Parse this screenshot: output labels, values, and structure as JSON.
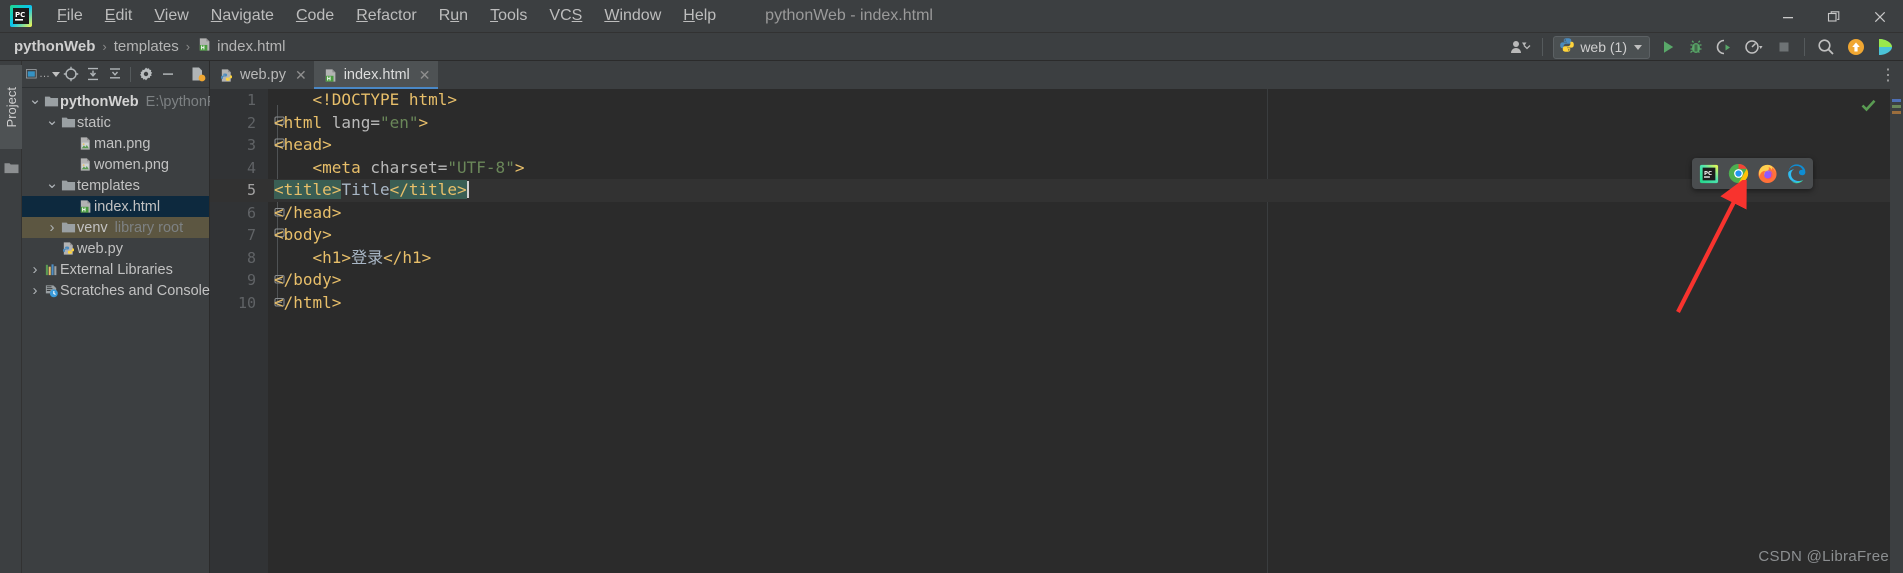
{
  "window": {
    "title": "pythonWeb - index.html",
    "controls": [
      {
        "name": "minimize",
        "glyph": "—"
      },
      {
        "name": "restore",
        "glyph": "❐"
      },
      {
        "name": "close",
        "glyph": "✕"
      }
    ]
  },
  "menubar": {
    "logo_text": "PC",
    "items": [
      {
        "label": "File",
        "mnemonic": "F"
      },
      {
        "label": "Edit",
        "mnemonic": "E"
      },
      {
        "label": "View",
        "mnemonic": "V"
      },
      {
        "label": "Navigate",
        "mnemonic": "N"
      },
      {
        "label": "Code",
        "mnemonic": "C"
      },
      {
        "label": "Refactor",
        "mnemonic": "R"
      },
      {
        "label": "Run",
        "mnemonic": "u"
      },
      {
        "label": "Tools",
        "mnemonic": "T"
      },
      {
        "label": "VCS",
        "mnemonic": "S"
      },
      {
        "label": "Window",
        "mnemonic": "W"
      },
      {
        "label": "Help",
        "mnemonic": "H"
      }
    ]
  },
  "navbar": {
    "breadcrumb": [
      {
        "label": "pythonWeb",
        "bold": true,
        "icon": ""
      },
      {
        "label": "templates",
        "bold": false,
        "icon": ""
      },
      {
        "label": "index.html",
        "bold": false,
        "icon": "html-file-icon"
      }
    ],
    "separator": "›",
    "run_config": {
      "label": "web (1)",
      "icon": "python-icon"
    },
    "actions": [
      {
        "name": "user-settings-icon",
        "label": ""
      },
      {
        "name": "run-icon",
        "label": ""
      },
      {
        "name": "debug-icon",
        "label": ""
      },
      {
        "name": "run-coverage-icon",
        "label": ""
      },
      {
        "name": "profile-icon",
        "label": ""
      },
      {
        "name": "stop-icon",
        "label": ""
      },
      {
        "name": "search-everywhere-icon",
        "label": ""
      },
      {
        "name": "update-project-icon",
        "label": ""
      }
    ]
  },
  "toolstrip": {
    "tab_label": "Project"
  },
  "project_panel": {
    "toolbar_buttons": [
      {
        "name": "project-view-selector",
        "label": "..."
      },
      {
        "name": "locate-icon",
        "label": ""
      },
      {
        "name": "expand-all-icon",
        "label": ""
      },
      {
        "name": "collapse-all-icon",
        "label": ""
      },
      {
        "name": "settings-gear-icon",
        "label": ""
      },
      {
        "name": "hide-panel-icon",
        "label": ""
      }
    ],
    "tree": [
      {
        "indent": 0,
        "arrow": "down",
        "icon": "folder-icon",
        "label": "pythonWeb",
        "bold": true,
        "sub": "E:\\pythonF",
        "state": "normal"
      },
      {
        "indent": 1,
        "arrow": "down",
        "icon": "folder-icon",
        "label": "static",
        "bold": false,
        "sub": "",
        "state": "normal"
      },
      {
        "indent": 2,
        "arrow": "none",
        "icon": "image-file-icon",
        "label": "man.png",
        "bold": false,
        "sub": "",
        "state": "normal"
      },
      {
        "indent": 2,
        "arrow": "none",
        "icon": "image-file-icon",
        "label": "women.png",
        "bold": false,
        "sub": "",
        "state": "normal"
      },
      {
        "indent": 1,
        "arrow": "down",
        "icon": "folder-icon",
        "label": "templates",
        "bold": false,
        "sub": "",
        "state": "normal"
      },
      {
        "indent": 2,
        "arrow": "none",
        "icon": "html-file-icon",
        "label": "index.html",
        "bold": false,
        "sub": "",
        "state": "selected"
      },
      {
        "indent": 1,
        "arrow": "right",
        "icon": "folder-icon",
        "label": "venv",
        "bold": false,
        "sub": "library root",
        "state": "highlight"
      },
      {
        "indent": 1,
        "arrow": "none",
        "icon": "python-file-icon",
        "label": "web.py",
        "bold": false,
        "sub": "",
        "state": "normal"
      },
      {
        "indent": 0,
        "arrow": "right",
        "icon": "libraries-icon",
        "label": "External Libraries",
        "bold": false,
        "sub": "",
        "state": "normal"
      },
      {
        "indent": 0,
        "arrow": "right",
        "icon": "scratches-icon",
        "label": "Scratches and Consoles",
        "bold": false,
        "sub": "",
        "state": "normal"
      }
    ]
  },
  "editor": {
    "tabs": [
      {
        "label": "web.py",
        "icon": "python-file-icon",
        "active": false,
        "close": "✕"
      },
      {
        "label": "index.html",
        "icon": "html-file-icon",
        "active": true,
        "close": "✕"
      }
    ],
    "options_glyph": "⋮",
    "inspection_status": "ok-check-icon",
    "current_line": 5,
    "lines": [
      {
        "no": "1",
        "fold": "",
        "bulb": false,
        "tokens": [
          {
            "t": "    ",
            "c": "plain"
          },
          {
            "t": "<!DOCTYPE html>",
            "c": "tag"
          }
        ]
      },
      {
        "no": "2",
        "fold": "open",
        "bulb": false,
        "tokens": [
          {
            "t": "<html ",
            "c": "tag"
          },
          {
            "t": "lang=",
            "c": "attr"
          },
          {
            "t": "\"en\"",
            "c": "str"
          },
          {
            "t": ">",
            "c": "tag"
          }
        ]
      },
      {
        "no": "3",
        "fold": "open",
        "bulb": false,
        "tokens": [
          {
            "t": "<head>",
            "c": "tag"
          }
        ]
      },
      {
        "no": "4",
        "fold": "",
        "bulb": false,
        "tokens": [
          {
            "t": "    ",
            "c": "plain"
          },
          {
            "t": "<meta ",
            "c": "tag"
          },
          {
            "t": "charset=",
            "c": "attr"
          },
          {
            "t": "\"UTF-8\"",
            "c": "str"
          },
          {
            "t": ">",
            "c": "tag"
          }
        ]
      },
      {
        "no": "5",
        "fold": "",
        "bulb": true,
        "tokens": [
          {
            "t": "<title>",
            "c": "tag-sel"
          },
          {
            "t": "Title",
            "c": "text"
          },
          {
            "t": "</title>",
            "c": "tag-sel"
          }
        ]
      },
      {
        "no": "6",
        "fold": "close",
        "bulb": false,
        "tokens": [
          {
            "t": "</head>",
            "c": "tag"
          }
        ]
      },
      {
        "no": "7",
        "fold": "open",
        "bulb": false,
        "tokens": [
          {
            "t": "<body>",
            "c": "tag"
          }
        ]
      },
      {
        "no": "8",
        "fold": "",
        "bulb": false,
        "tokens": [
          {
            "t": "    ",
            "c": "plain"
          },
          {
            "t": "<h1>",
            "c": "tag"
          },
          {
            "t": "登录",
            "c": "text"
          },
          {
            "t": "</h1>",
            "c": "tag"
          }
        ]
      },
      {
        "no": "9",
        "fold": "close",
        "bulb": false,
        "tokens": [
          {
            "t": "</body>",
            "c": "tag"
          }
        ]
      },
      {
        "no": "10",
        "fold": "close",
        "bulb": false,
        "tokens": [
          {
            "t": "</html>",
            "c": "tag"
          }
        ]
      }
    ]
  },
  "browser_popup": {
    "icons": [
      {
        "name": "pycharm-preview-icon",
        "title": "PyCharm built-in preview"
      },
      {
        "name": "chrome-icon",
        "title": "Chrome"
      },
      {
        "name": "firefox-icon",
        "title": "Firefox"
      },
      {
        "name": "edge-icon",
        "title": "Edge"
      }
    ]
  },
  "annotation": {
    "arrow_color": "#f8332e",
    "points_to": "chrome-icon"
  },
  "watermark": {
    "text": "CSDN @LibraFree"
  },
  "colors": {
    "chrome_url_bg": "#3c3f41",
    "editor_bg": "#2b2b2b",
    "tag": "#e8bf6a",
    "string": "#6a8759",
    "text": "#a9b7c6",
    "selection": "#3a5e54",
    "tree_selected": "#0d293e",
    "tree_highlight": "#5c5641",
    "tab_underline": "#4a88c7"
  }
}
